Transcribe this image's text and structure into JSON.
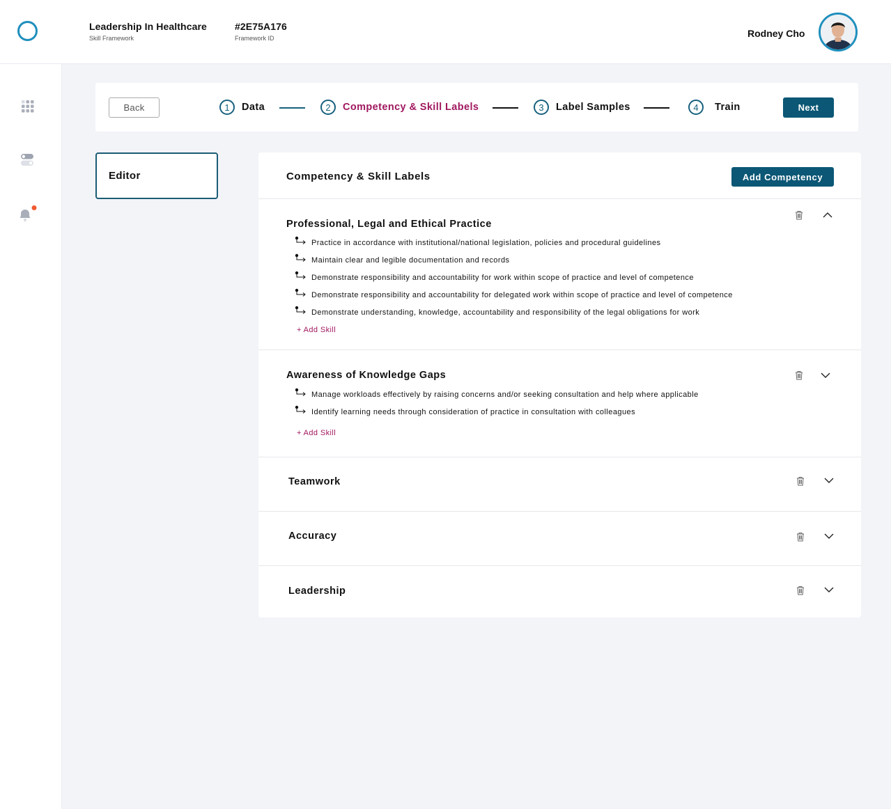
{
  "header": {
    "framework_name": "Leadership In Healthcare",
    "framework_name_label": "Skill Framework",
    "framework_id": "#2E75A176",
    "framework_id_label": "Framework ID",
    "user_name": "Rodney Cho",
    "logo_icon": "ring-logo",
    "accent_color": "#1f8fbd"
  },
  "sidebar": {
    "items": [
      {
        "icon": "grid-icon",
        "label": "Apps"
      },
      {
        "icon": "toggle-icon",
        "label": "Settings"
      },
      {
        "icon": "bell-icon",
        "label": "Notifications",
        "badge_color": "#f05a30"
      }
    ]
  },
  "stepper": {
    "back_label": "Back",
    "next_label": "Next",
    "steps": [
      {
        "number": "1",
        "label": "Data",
        "state": "done"
      },
      {
        "number": "2",
        "label": "Competency & Skill Labels",
        "state": "active"
      },
      {
        "number": "3",
        "label": "Label Samples",
        "state": "pending"
      },
      {
        "number": "4",
        "label": "Train",
        "state": "pending"
      }
    ],
    "active_color": "#a0185f",
    "primary_color": "#0b5775"
  },
  "side_tabs": {
    "editor_label": "Editor"
  },
  "panel": {
    "title": "Competency & Skill Labels",
    "add_competency_label": "Add Competency",
    "add_skill_label": "+ Add Skill",
    "competencies": [
      {
        "title": "Professional, Legal and Ethical Practice",
        "expanded": true,
        "skills": [
          "Practice in accordance with institutional/national legislation, policies and procedural guidelines",
          "Maintain clear and legible documentation and records",
          "Demonstrate responsibility and accountability for work within scope of practice and level of competence",
          "Demonstrate responsibility and accountability for delegated work within scope of practice and level of competence",
          "Demonstrate understanding, knowledge, accountability and responsibility of the legal obligations for work"
        ]
      },
      {
        "title": "Awareness of Knowledge Gaps",
        "expanded": false,
        "skills": [
          "Manage workloads effectively by raising concerns and/or seeking consultation and help where applicable",
          "Identify learning needs through consideration of practice in consultation with colleagues"
        ]
      },
      {
        "title": "Teamwork",
        "expanded": false,
        "skills": []
      },
      {
        "title": "Accuracy",
        "expanded": false,
        "skills": []
      },
      {
        "title": "Leadership",
        "expanded": false,
        "skills": []
      }
    ]
  }
}
